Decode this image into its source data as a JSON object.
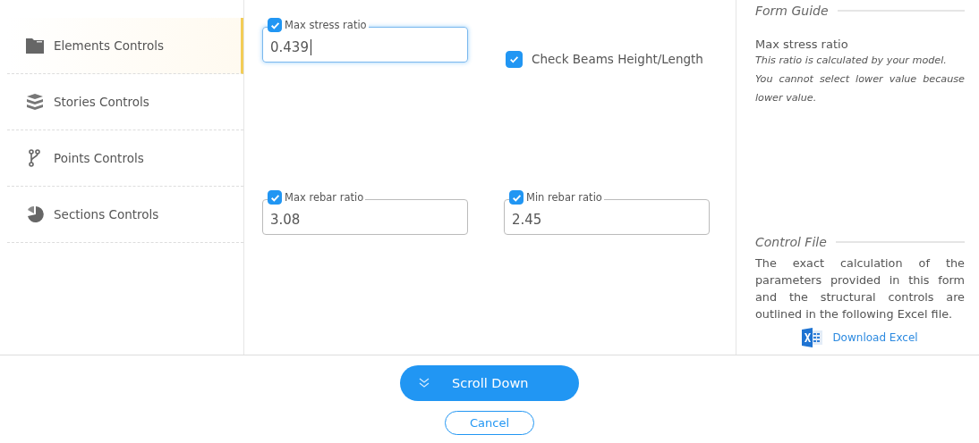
{
  "sidebar": {
    "items": [
      {
        "label": "Elements Controls",
        "selected": true
      },
      {
        "label": "Stories Controls",
        "selected": false
      },
      {
        "label": "Points Controls",
        "selected": false
      },
      {
        "label": "Sections Controls",
        "selected": false
      }
    ]
  },
  "fields": [
    {
      "kind": "input",
      "label": "Max stress ratio",
      "checked": true,
      "value": "0.439",
      "focused": true
    },
    {
      "kind": "checkbox",
      "label": "Check Beams Height/Length",
      "checked": true
    },
    {
      "kind": "input",
      "label": "Max rebar ratio",
      "checked": true,
      "value": "3.08",
      "focused": false
    },
    {
      "kind": "input",
      "label": "Min rebar ratio",
      "checked": true,
      "value": "2.45",
      "focused": false
    }
  ],
  "guide": {
    "title": "Form Guide",
    "heading": "Max stress ratio",
    "lines": [
      "This ratio is calculated by your model.",
      "You cannot select lower value because lower value."
    ]
  },
  "control_file": {
    "title": "Control File",
    "text": "The exact calculation of the parameters provided in this form and the structural controls are outlined in the following Excel file.",
    "link": "Download Excel"
  },
  "buttons": {
    "primary": "Scroll Down",
    "secondary": "Cancel"
  }
}
